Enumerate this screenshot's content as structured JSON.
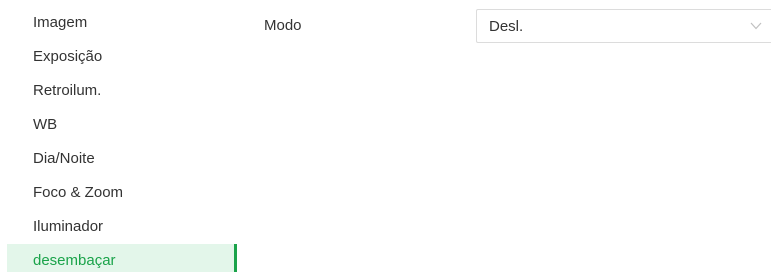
{
  "sidebar": {
    "items": [
      {
        "label": "Imagem"
      },
      {
        "label": "Exposição"
      },
      {
        "label": "Retroilum."
      },
      {
        "label": "WB"
      },
      {
        "label": "Dia/Noite"
      },
      {
        "label": "Foco & Zoom"
      },
      {
        "label": "Iluminador"
      },
      {
        "label": "desembaçar",
        "active": true
      }
    ]
  },
  "main": {
    "mode": {
      "label": "Modo",
      "value": "Desl."
    }
  },
  "icons": {
    "select_arrow": "chevron-down-icon"
  },
  "colors": {
    "accent": "#1aa34a",
    "active_bg": "#e3f6ea",
    "text": "#333333",
    "border": "#dcdcdc"
  }
}
